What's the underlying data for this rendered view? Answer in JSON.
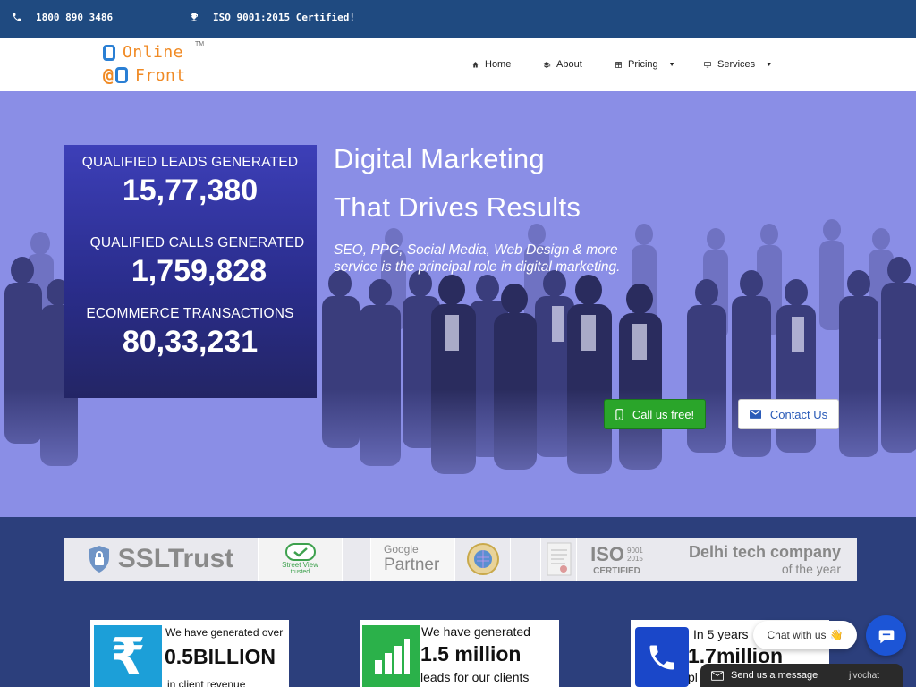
{
  "topbar": {
    "phone": "1800 890 3486",
    "certification": "ISO 9001:2015 Certified!"
  },
  "logo": {
    "line1": "Online",
    "line2": "Front",
    "tm": "TM"
  },
  "menu": {
    "home": "Home",
    "about": "About",
    "pricing": "Pricing",
    "services": "Services"
  },
  "stats": {
    "leads_label": "QUALIFIED LEADS GENERATED",
    "leads_value": "15,77,380",
    "calls_label": "QUALIFIED CALLS GENERATED",
    "calls_value": "1,759,828",
    "ecom_label": "ECOMMERCE TRANSACTIONS",
    "ecom_value": "80,33,231"
  },
  "hero": {
    "headline1": "Digital Marketing",
    "headline2": "That Drives Results",
    "subline1": "SEO, PPC, Social Media, Web Design & more",
    "subline2": "service is the principal role in digital marketing.",
    "call_btn": "Call us free!",
    "contact_btn": "Contact Us"
  },
  "trust": {
    "ssl": "SSLTrust",
    "streetview1": "Street View",
    "streetview2": "trusted",
    "google1": "Google",
    "google2": "Partner",
    "iso_num": "9001",
    "iso_year": "2015",
    "iso_word": "ISO",
    "iso_cert": "CERTIFIED",
    "delhi1": "Delhi tech company",
    "delhi2": "of the year"
  },
  "cards": [
    {
      "t1": "We have generated over",
      "t2": "0.5BILLION",
      "t3": "in client revenue"
    },
    {
      "t1": "We have generated",
      "t2": "1.5 million",
      "t3": "leads for our clients"
    },
    {
      "t1": "In 5 years",
      "t2": "1.7million",
      "t3": "pl"
    }
  ],
  "chat": {
    "pill": "Chat with us",
    "send": "Send us a message",
    "brand": "jivochat"
  },
  "colors": {
    "topbar": "#1f4a80",
    "hero": "#8a8ee6",
    "stats_panel": "#3d3fb8",
    "call_btn": "#2aa52a",
    "logo_orange": "#f08a24",
    "logo_blue": "#2a7fd4"
  }
}
